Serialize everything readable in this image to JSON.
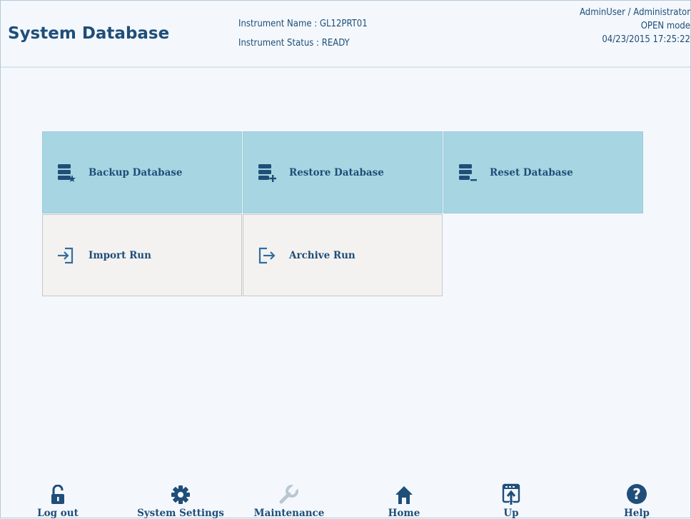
{
  "header": {
    "title": "System Database",
    "instrument_name": "Instrument Name : GL12PRT01",
    "instrument_status": "Instrument Status : READY",
    "user": "AdminUser / Administrator",
    "mode": "OPEN mode",
    "datetime": "04/23/2015 17:25:22"
  },
  "tiles": {
    "backup": {
      "label": "Backup Database",
      "icon": "database-backup-icon"
    },
    "restore": {
      "label": "Restore Database",
      "icon": "database-restore-icon"
    },
    "reset": {
      "label": "Reset Database",
      "icon": "database-reset-icon"
    },
    "import": {
      "label": "Import Run",
      "icon": "import-icon"
    },
    "archive": {
      "label": "Archive Run",
      "icon": "archive-icon"
    }
  },
  "toolbar": {
    "logout": {
      "label": "Log out",
      "icon": "unlock-icon"
    },
    "settings": {
      "label": "System Settings",
      "icon": "gear-icon"
    },
    "maintenance": {
      "label": "Maintenance",
      "icon": "wrench-icon"
    },
    "home": {
      "label": "Home",
      "icon": "home-icon"
    },
    "up": {
      "label": "Up",
      "icon": "up-icon"
    },
    "help": {
      "label": "Help",
      "icon": "help-icon"
    }
  },
  "colors": {
    "accent": "#1f4e79",
    "tile_blue": "#a7d6e2",
    "tile_grey": "#f4f2f0",
    "background": "#f4f8fc"
  }
}
